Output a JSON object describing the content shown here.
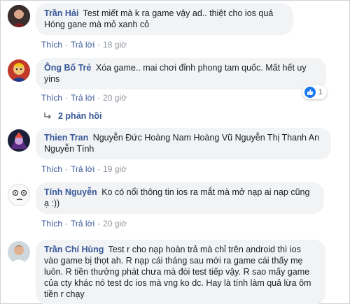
{
  "comments": [
    {
      "author": "Trần Hải",
      "text": "Test miết mà k ra game vậy ad.. thiệt cho ios quá Hóng gane mà mỏ xanh cỏ",
      "like_label": "Thích",
      "reply_label": "Trả lời",
      "time": "18 giờ"
    },
    {
      "author": "Ông Bố Trẻ",
      "text": "Xóa game.. mai chơi đỉnh phong tam quốc. Mất hết uy yins",
      "like_label": "Thích",
      "reply_label": "Trả lời",
      "time": "20 giờ",
      "reaction_count": "1",
      "replies_label": "2 phản hồi"
    },
    {
      "author": "Thien Tran",
      "text": "Nguyễn Đức Hoàng Nam Hoàng Vũ Nguyễn Thị Thanh An Nguyễn Tính",
      "like_label": "Thích",
      "reply_label": "Trả lời",
      "time": "19 giờ"
    },
    {
      "author": "Tính Nguyễn",
      "text": "Ko có nổi thông tin ios ra mắt mà mở nạp ai nạp cũng ạ :))",
      "like_label": "Thích",
      "reply_label": "Trả lời",
      "time": "20 giờ"
    },
    {
      "author": "Trần Chí Hùng",
      "text": "Test r cho nạp hoàn trả mà chỉ trên android thì ios vào game bị thọt ah. R nạp cái tháng sau mới ra game cái thấy mẹ luôn. R tiền thưởng phát chưa mà đòi test tiếp vậy. R sao mấy game của cty khác nó test dc ios mà vng ko dc. Hay là tính làm quả lừa ôm tiền r chạy"
    }
  ],
  "colors": {
    "author": "#385898",
    "bubble": "#f2f3f5",
    "like_blue": "#1877f2"
  }
}
